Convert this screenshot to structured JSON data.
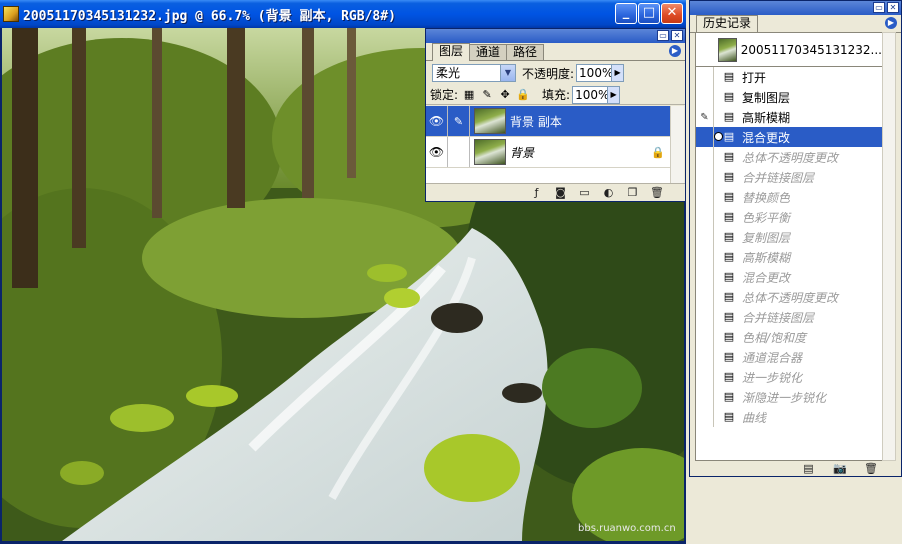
{
  "doc": {
    "title": "20051170345131232.jpg @ 66.7% (背景 副本, RGB/8#)",
    "watermark": "bbs.ruanwo.com.cn"
  },
  "layers_palette": {
    "tabs": [
      {
        "label": "图层",
        "active": true
      },
      {
        "label": "通道",
        "active": false
      },
      {
        "label": "路径",
        "active": false
      }
    ],
    "blend_mode": "柔光",
    "opacity_label": "不透明度:",
    "opacity_value": "100%",
    "lock_label": "锁定:",
    "fill_label": "填充:",
    "fill_value": "100%",
    "layers": [
      {
        "name": "背景 副本",
        "selected": true
      },
      {
        "name": "背景",
        "selected": false
      }
    ]
  },
  "history_palette": {
    "tab_label": "历史记录",
    "snapshot_name": "20051170345131232...",
    "items": [
      {
        "label": "打开",
        "active": true
      },
      {
        "label": "复制图层",
        "active": true
      },
      {
        "label": "高斯模糊",
        "active": true,
        "source": true
      },
      {
        "label": "混合更改",
        "active": true,
        "selected": true
      },
      {
        "label": "总体不透明度更改",
        "active": false
      },
      {
        "label": "合并链接图层",
        "active": false
      },
      {
        "label": "替换颜色",
        "active": false
      },
      {
        "label": "色彩平衡",
        "active": false
      },
      {
        "label": "复制图层",
        "active": false
      },
      {
        "label": "高斯模糊",
        "active": false
      },
      {
        "label": "混合更改",
        "active": false
      },
      {
        "label": "总体不透明度更改",
        "active": false
      },
      {
        "label": "合并链接图层",
        "active": false
      },
      {
        "label": "色相/饱和度",
        "active": false
      },
      {
        "label": "通道混合器",
        "active": false
      },
      {
        "label": "进一步锐化",
        "active": false
      },
      {
        "label": "渐隐进一步锐化",
        "active": false
      },
      {
        "label": "曲线",
        "active": false
      }
    ]
  }
}
